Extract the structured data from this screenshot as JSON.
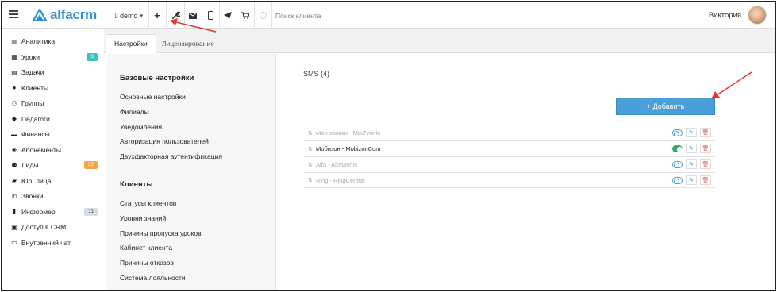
{
  "topbar": {
    "logo_text": "alfacrm",
    "account_label": "demo",
    "account_caret": "▾",
    "plus_label": "+",
    "search_placeholder": "Поиск клиента",
    "user_name": "Виктория"
  },
  "sidebar": {
    "items": [
      {
        "label": "Аналитика",
        "icon": "chart-icon"
      },
      {
        "label": "Уроки",
        "icon": "calendar-icon",
        "badge": "3",
        "badge_color": "#3cc0c0"
      },
      {
        "label": "Задачи",
        "icon": "clipboard-icon"
      },
      {
        "label": "Клиенты",
        "icon": "user-icon"
      },
      {
        "label": "Группы",
        "icon": "users-icon"
      },
      {
        "label": "Педагоги",
        "icon": "graduation-cap-icon"
      },
      {
        "label": "Финансы",
        "icon": "money-icon"
      },
      {
        "label": "Абонементы",
        "icon": "tag-icon"
      },
      {
        "label": "Лиды",
        "icon": "user-plus-icon",
        "badge": "32",
        "badge_color": "#f5a64a"
      },
      {
        "label": "Юр. лица",
        "icon": "briefcase-icon"
      },
      {
        "label": "Звонки",
        "icon": "phone-icon"
      },
      {
        "label": "Информер",
        "icon": "book-icon",
        "badge": "11",
        "badge_color": "#d6dde3"
      },
      {
        "label": "Доступ в CRM",
        "icon": "lock-icon"
      },
      {
        "label": "Внутренний чат",
        "icon": "chat-icon"
      }
    ]
  },
  "tabs": [
    {
      "label": "Настройки",
      "active": true
    },
    {
      "label": "Лицензирование",
      "active": false
    }
  ],
  "settings": {
    "basic_title": "Базовые настройки",
    "basic_links": [
      "Основные настройки",
      "Филиалы",
      "Уведомления",
      "Авторизация пользователей",
      "Двухфакторная аутентификация"
    ],
    "clients_title": "Клиенты",
    "clients_links": [
      "Статусы клиентов",
      "Уровни знаний",
      "Причины пропуска уроков",
      "Кабинет клиента",
      "Причины отказов",
      "Система лояльности"
    ]
  },
  "main": {
    "title": "SMS (4)",
    "add_button": "+ Добавить",
    "providers": [
      {
        "name": "Мои звонки - MoiZvonki",
        "enabled": false
      },
      {
        "name": "Мобизон - MobizonCom",
        "enabled": true
      },
      {
        "name": "Alfa - Alphasms",
        "enabled": false
      },
      {
        "name": "Ring - RingCentral",
        "enabled": false
      }
    ]
  },
  "colors": {
    "accent": "#2f8fd6",
    "add_button": "#4a9fd8",
    "toggle_on": "#3aa86a",
    "arrow": "#e03a2f"
  }
}
